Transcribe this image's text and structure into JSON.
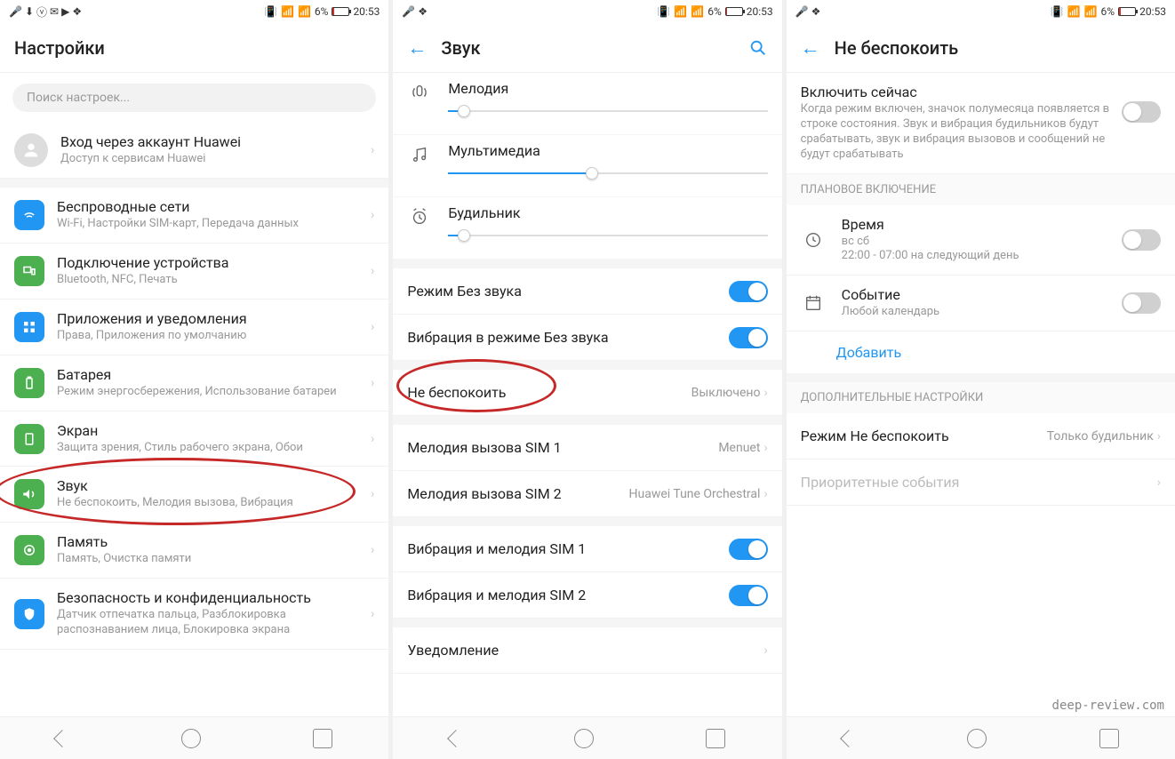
{
  "status": {
    "battery_pct": "6%",
    "time": "20:53"
  },
  "screen1": {
    "title": "Настройки",
    "search_placeholder": "Поиск настроек...",
    "account": {
      "title": "Вход через аккаунт Huawei",
      "sub": "Доступ к сервисам Huawei"
    },
    "items": [
      {
        "title": "Беспроводные сети",
        "sub": "Wi-Fi, Настройки SIM-карт, Передача данных"
      },
      {
        "title": "Подключение устройства",
        "sub": "Bluetooth, NFC, Печать"
      },
      {
        "title": "Приложения и уведомления",
        "sub": "Права, Приложения по умолчанию"
      },
      {
        "title": "Батарея",
        "sub": "Режим энергосбережения, Использование батареи"
      },
      {
        "title": "Экран",
        "sub": "Защита зрения, Стиль рабочего экрана, Обои"
      },
      {
        "title": "Звук",
        "sub": "Не беспокоить, Мелодия вызова, Вибрация"
      },
      {
        "title": "Память",
        "sub": "Память, Очистка памяти"
      },
      {
        "title": "Безопасность и конфиденциальность",
        "sub": "Датчик отпечатка пальца, Разблокировка распознаванием лица, Блокировка экрана"
      }
    ]
  },
  "screen2": {
    "title": "Звук",
    "sliders": [
      {
        "label": "Мелодия",
        "pct": 5
      },
      {
        "label": "Мультимедиа",
        "pct": 45
      },
      {
        "label": "Будильник",
        "pct": 5
      }
    ],
    "silent_label": "Режим Без звука",
    "vibrate_silent_label": "Вибрация в режиме Без звука",
    "dnd_label": "Не беспокоить",
    "dnd_value": "Выключено",
    "ring1_label": "Мелодия вызова SIM 1",
    "ring1_value": "Menuet",
    "ring2_label": "Мелодия вызова SIM 2",
    "ring2_value": "Huawei Tune Orchestral",
    "vib_ring1": "Вибрация и мелодия SIM 1",
    "vib_ring2": "Вибрация и мелодия SIM 2",
    "notif_label": "Уведомление"
  },
  "screen3": {
    "title": "Не беспокоить",
    "enable_now": {
      "title": "Включить сейчас",
      "sub": "Когда режим включен, значок полумесяца появляется в строке состояния. Звук и вибрация будильников будут срабатывать, звук и вибрация вызовов и сообщений не будут срабатывать"
    },
    "section_schedule": "ПЛАНОВОЕ ВКЛЮЧЕНИЕ",
    "time_item": {
      "title": "Время",
      "sub1": "вс сб",
      "sub2": "22:00 - 07:00 на следующий день"
    },
    "event_item": {
      "title": "Событие",
      "sub": "Любой календарь"
    },
    "add_label": "Добавить",
    "section_more": "ДОПОЛНИТЕЛЬНЫЕ НАСТРОЙКИ",
    "dnd_mode_label": "Режим Не беспокоить",
    "dnd_mode_value": "Только будильник",
    "priority_label": "Приоритетные события"
  },
  "watermark": "deep-review.com"
}
